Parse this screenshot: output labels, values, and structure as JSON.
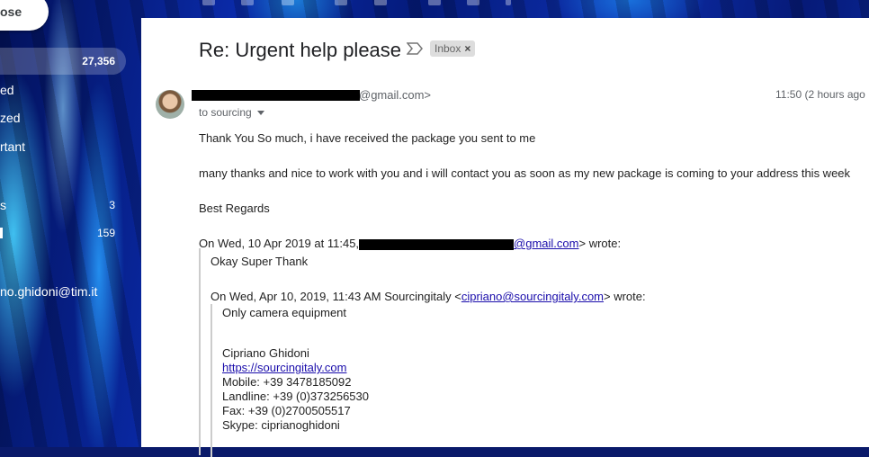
{
  "sidebar": {
    "compose_label": "ose",
    "items": [
      {
        "label": "",
        "count": "27,356"
      },
      {
        "label": "ed",
        "count": ""
      },
      {
        "label": "zed",
        "count": ""
      },
      {
        "label": "rtant",
        "count": ""
      },
      {
        "label": "s",
        "count": "3"
      },
      {
        "label": "",
        "count": "159"
      }
    ],
    "account": "no.ghidoni@tim.it"
  },
  "email": {
    "subject": "Re: Urgent help please",
    "label_chip": "Inbox",
    "label_chip_close": "×",
    "from_suffix": "@gmail.com>",
    "time": "11:50 (2 hours ago",
    "to": "to sourcing",
    "body": [
      "Thank You So much, i have received the package you sent to me",
      "many thanks and nice to work with you and i will contact you as soon as my new package is coming to your address this week",
      "Best Regards"
    ],
    "quote1_header_prefix": "On Wed, 10 Apr 2019 at 11:45,",
    "quote1_header_link": "@gmail.com",
    "quote1_header_suffix": "> wrote:",
    "quote1_text": "Okay Super Thank",
    "quote2_header_prefix": "On Wed, Apr 10, 2019, 11:43 AM Sourcingitaly <",
    "quote2_header_link": "cipriano@sourcingitaly.com",
    "quote2_header_suffix": "> wrote:",
    "quote2_text": "Only camera equipment",
    "signature": {
      "name": "Cipriano Ghidoni",
      "website": "https://sourcingitaly.com",
      "mobile": "Mobile: +39 3478185092",
      "landline": "Landline: +39 (0)373256530",
      "fax": "Fax: +39 (0)2700505517",
      "skype": "Skype: ciprianoghidoni"
    }
  }
}
